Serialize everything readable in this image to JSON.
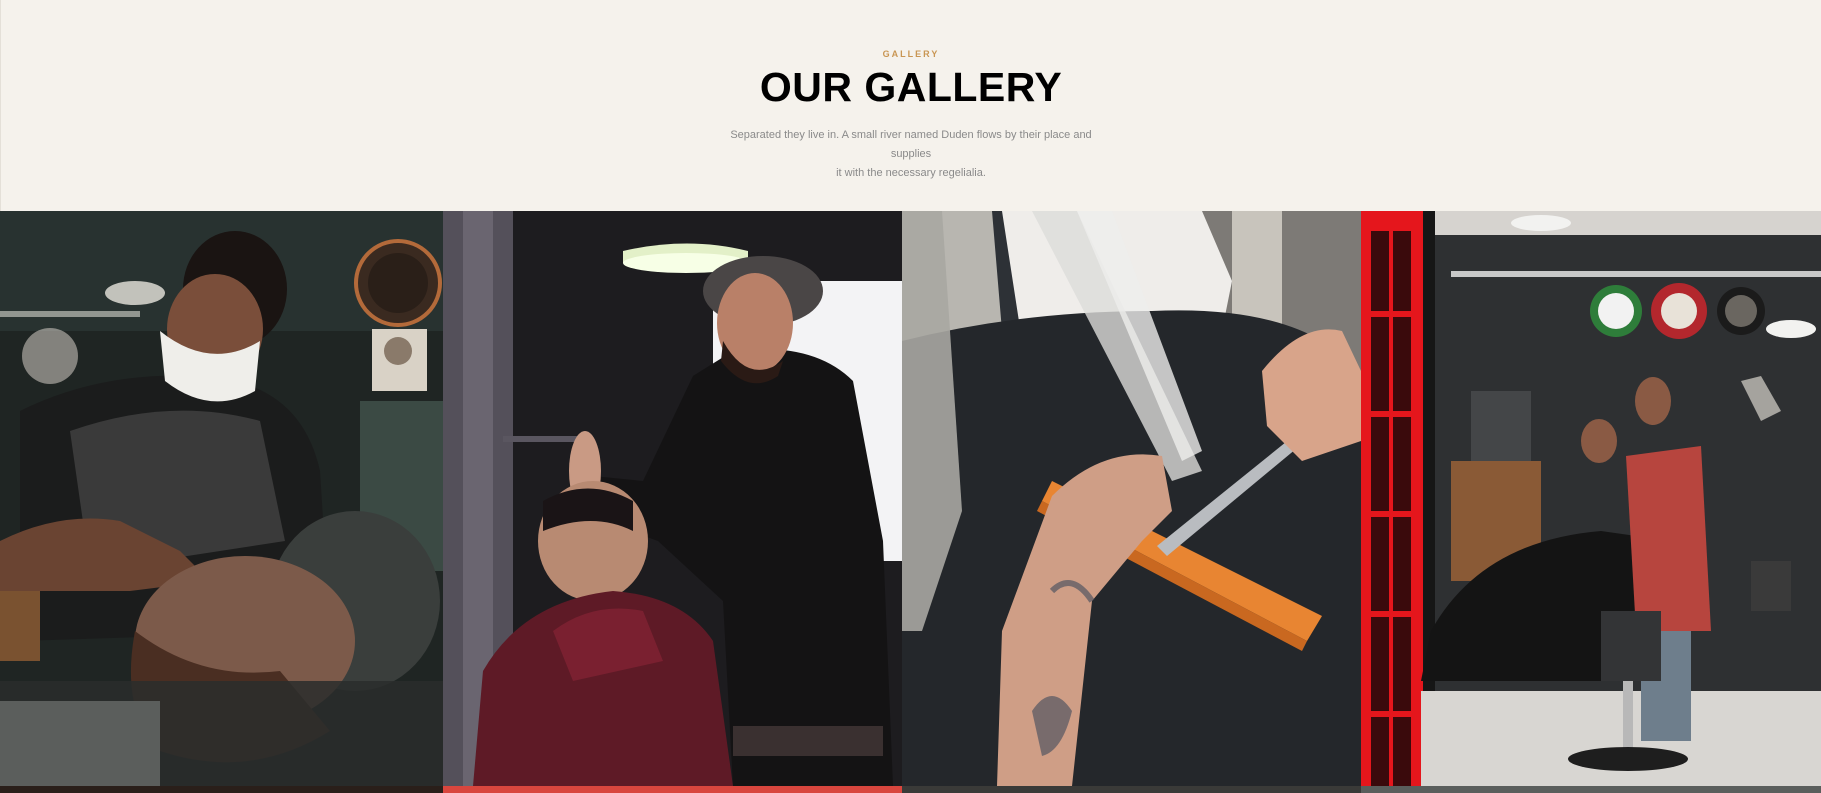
{
  "heading": {
    "subheading": "Gallery",
    "title": "OUR GALLERY",
    "description_line1": "Separated they live in. A small river named Duden flows by their place and supplies",
    "description_line2": "it with the necessary regelialia."
  },
  "gallery": {
    "items": [
      {
        "name": "barber-beard-trim-photo",
        "alt": "Barber in face mask trimming a client's beard"
      },
      {
        "name": "barber-cutting-hair-photo",
        "alt": "Barber in flat cap cutting a client's hair"
      },
      {
        "name": "hair-comb-scissors-photo",
        "alt": "Stylist cutting blonde hair with comb and scissors"
      },
      {
        "name": "barbershop-interior-photo",
        "alt": "Barbershop interior with red door and barber chair"
      }
    ]
  },
  "brand_colors": {
    "accent": "#c99653",
    "background": "#f5f2ec",
    "title": "#000000",
    "text": "#8a8a8a"
  }
}
